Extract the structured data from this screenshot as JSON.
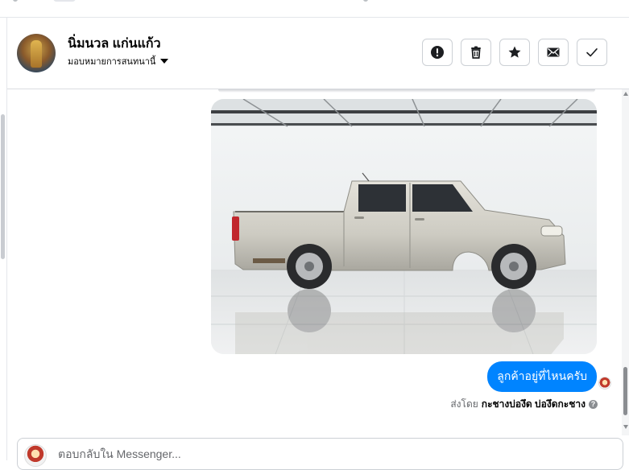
{
  "header": {
    "contact_name": "นิ่มนวล แก่นแก้ว",
    "assign_label": "มอบหมายการสนทนานี้",
    "tools": [
      {
        "name": "mark-spam",
        "icon": "exclamation-circle-icon"
      },
      {
        "name": "delete",
        "icon": "trash-icon"
      },
      {
        "name": "star",
        "icon": "star-icon"
      },
      {
        "name": "mark-unread",
        "icon": "envelope-icon"
      },
      {
        "name": "mark-done",
        "icon": "checkmark-icon"
      }
    ]
  },
  "conversation": {
    "image_message": {
      "alt": "",
      "icon": "pickup-truck-photo"
    },
    "message_text": "ลูกค้าอยู่ที่ไหนครับ",
    "sent_by_prefix": "ส่งโดย",
    "sent_by_name": "กะชางบ่องึด บ่องึดกะชาง"
  },
  "composer": {
    "placeholder": "ตอบกลับใน Messenger..."
  },
  "colors": {
    "accent": "#0084ff",
    "border": "#ccd0d5",
    "text": "#050505",
    "muted": "#65676b"
  }
}
